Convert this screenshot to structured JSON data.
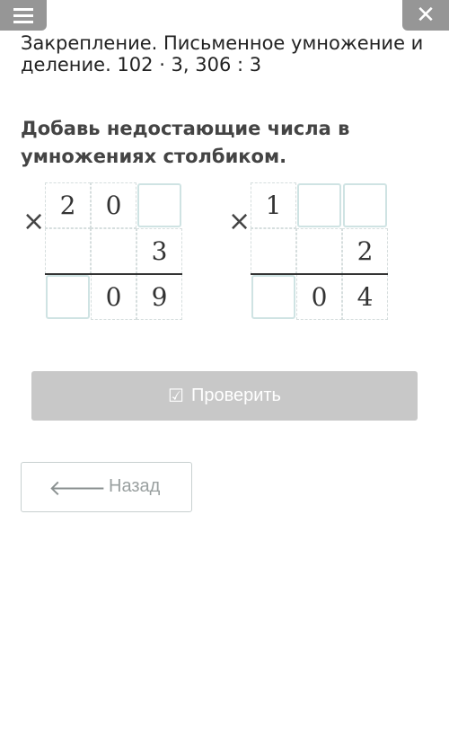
{
  "header": {
    "menu_icon": "hamburger-icon",
    "close_icon": "close-icon",
    "close_glyph": "✕"
  },
  "lesson": {
    "title": "Закрепление. Письменное умножение и деление. 102 · 3, 306 : 3"
  },
  "task": {
    "text": "Добавь недостающие числа в умножениях столбиком."
  },
  "exercises": [
    {
      "sign": "×",
      "rows": [
        [
          "2",
          "0",
          ""
        ],
        [
          "",
          "",
          "3"
        ],
        [
          "",
          "0",
          "9"
        ]
      ]
    },
    {
      "sign": "×",
      "rows": [
        [
          "1",
          "",
          ""
        ],
        [
          "",
          "",
          "2"
        ],
        [
          "",
          "0",
          "4"
        ]
      ]
    }
  ],
  "check_button": {
    "label": "Проверить",
    "icon": "check-square-icon"
  },
  "back_button": {
    "label": "Назад",
    "icon": "arrow-left-icon"
  }
}
